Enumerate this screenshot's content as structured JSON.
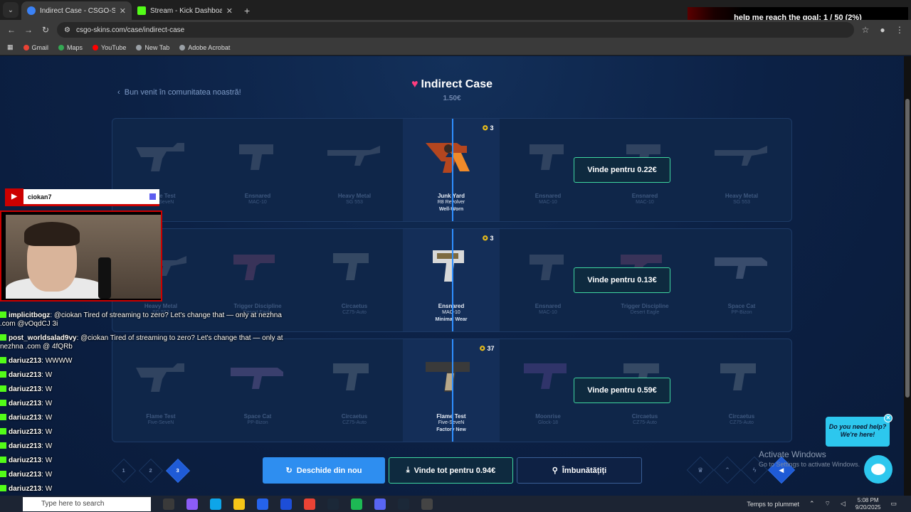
{
  "browser": {
    "tabs": [
      {
        "title": "Indirect Case - CSGO-SKIN",
        "active": true
      },
      {
        "title": "Stream - Kick Dashboard",
        "active": false
      }
    ],
    "url": "csgo-skins.com/case/indirect-case",
    "bookmarks": [
      "Gmail",
      "Maps",
      "YouTube",
      "New Tab",
      "Adobe Acrobat"
    ]
  },
  "goal_banner": "help me reach the goal: 1 / 50 (2%)",
  "page": {
    "back_link": "Bun venit în comunitatea noastră!",
    "case_title": "Indirect Case",
    "case_price": "1.50€"
  },
  "rows": [
    {
      "star_count": "3",
      "sell_label": "Vinde pentru 0.22€",
      "items": [
        {
          "name": "Flame Test",
          "weapon": "Five-SeveN"
        },
        {
          "name": "Ensnared",
          "weapon": "MAC-10"
        },
        {
          "name": "Heavy Metal",
          "weapon": "SG 553"
        },
        {
          "name": "Junk Yard",
          "weapon": "R8 Revolver",
          "wear": "Well-Worn"
        },
        {
          "name": "Ensnared",
          "weapon": "MAC-10"
        },
        {
          "name": "Ensnared",
          "weapon": "MAC-10"
        },
        {
          "name": "Heavy Metal",
          "weapon": "SG 553"
        }
      ]
    },
    {
      "star_count": "3",
      "sell_label": "Vinde pentru 0.13€",
      "items": [
        {
          "name": "Heavy Metal",
          "weapon": "SG 553"
        },
        {
          "name": "Trigger Discipline",
          "weapon": "Desert Eagle"
        },
        {
          "name": "Circaetus",
          "weapon": "CZ75-Auto"
        },
        {
          "name": "Ensnared",
          "weapon": "MAC-10",
          "wear": "Minimal Wear"
        },
        {
          "name": "Ensnared",
          "weapon": "MAC-10"
        },
        {
          "name": "Trigger Discipline",
          "weapon": "Desert Eagle"
        },
        {
          "name": "Space Cat",
          "weapon": "PP-Bizon"
        }
      ]
    },
    {
      "star_count": "37",
      "sell_label": "Vinde pentru 0.59€",
      "items": [
        {
          "name": "Flame Test",
          "weapon": "Five-SeveN"
        },
        {
          "name": "Space Cat",
          "weapon": "PP-Bizon"
        },
        {
          "name": "Circaetus",
          "weapon": "CZ75-Auto"
        },
        {
          "name": "Flame Test",
          "weapon": "Five-SeveN",
          "wear": "Factory New"
        },
        {
          "name": "Moonrise",
          "weapon": "Glock-18"
        },
        {
          "name": "Circaetus",
          "weapon": "CZ75-Auto"
        },
        {
          "name": "Circaetus",
          "weapon": "CZ75-Auto"
        }
      ]
    }
  ],
  "pagination": [
    "1",
    "2",
    "3"
  ],
  "actions": {
    "open_again": "Deschide din nou",
    "sell_all": "Vinde tot pentru 0.94€",
    "upgrade": "Îmbunătățiți"
  },
  "help_widget": {
    "line1": "Do you need help?",
    "line2": "We're here!"
  },
  "windows_watermark": {
    "title": "Activate Windows",
    "subtitle": "Go to Settings to activate Windows."
  },
  "stream_overlay": {
    "channel": "ciokan7",
    "chat": [
      {
        "user": "implicitbogz",
        "text": "@ciokan Tired of streaming to zero? Let's change that — only at nezhna .com @vOqdCJ 3i"
      },
      {
        "user": "post_worldsalad9vy",
        "text": "@ciokan Tired of streaming to zero? Let's change that — only at nezhna .com @ 4fQRb"
      },
      {
        "user": "dariuz213",
        "text": "WWWW"
      },
      {
        "user": "dariuz213",
        "text": "W"
      },
      {
        "user": "dariuz213",
        "text": "W"
      },
      {
        "user": "dariuz213",
        "text": "W"
      },
      {
        "user": "dariuz213",
        "text": "W"
      },
      {
        "user": "dariuz213",
        "text": "W"
      },
      {
        "user": "dariuz213",
        "text": "W"
      },
      {
        "user": "dariuz213",
        "text": "W"
      },
      {
        "user": "dariuz213",
        "text": "W"
      },
      {
        "user": "dariuz213",
        "text": "W"
      },
      {
        "user": "dariuz213",
        "text": "W"
      }
    ]
  },
  "taskbar": {
    "search_placeholder": "Type here to search",
    "weather": "Temps to plummet",
    "time": "5:08 PM",
    "date": "9/20/2025"
  }
}
